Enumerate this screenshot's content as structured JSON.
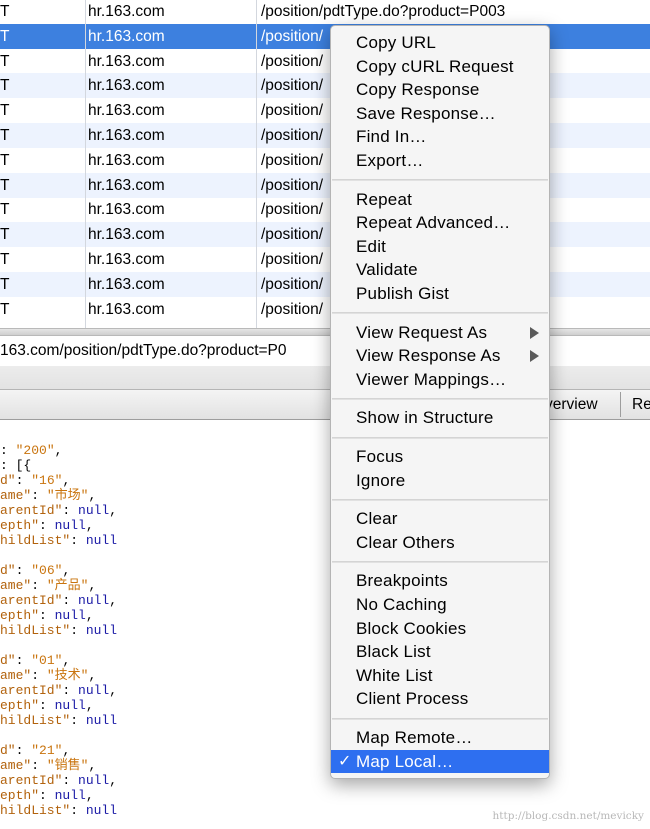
{
  "table": {
    "rows": [
      {
        "method": "T",
        "host": "hr.163.com",
        "path": "/position/pdtType.do?product=P003"
      },
      {
        "method": "T",
        "host": "hr.163.com",
        "path": "/position/"
      },
      {
        "method": "T",
        "host": "hr.163.com",
        "path": "/position/"
      },
      {
        "method": "T",
        "host": "hr.163.com",
        "path": "/position/"
      },
      {
        "method": "T",
        "host": "hr.163.com",
        "path": "/position/"
      },
      {
        "method": "T",
        "host": "hr.163.com",
        "path": "/position/"
      },
      {
        "method": "T",
        "host": "hr.163.com",
        "path": "/position/"
      },
      {
        "method": "T",
        "host": "hr.163.com",
        "path": "/position/"
      },
      {
        "method": "T",
        "host": "hr.163.com",
        "path": "/position/"
      },
      {
        "method": "T",
        "host": "hr.163.com",
        "path": "/position/"
      },
      {
        "method": "T",
        "host": "hr.163.com",
        "path": "/position/"
      },
      {
        "method": "T",
        "host": "hr.163.com",
        "path": "/position/"
      },
      {
        "method": "T",
        "host": "hr.163.com",
        "path": "/position/"
      }
    ]
  },
  "url_bar": {
    "text": "163.com/position/pdtType.do?product=P0"
  },
  "tabs": {
    "overview": "verview",
    "re": "Re"
  },
  "json": {
    "code_key": ": ",
    "code_val": "\"200\"",
    "data_open": ": [{",
    "items": [
      {
        "id": "\"16\"",
        "name": "\"市场\""
      },
      {
        "id": "\"06\"",
        "name": "\"产品\""
      },
      {
        "id": "\"01\"",
        "name": "\"技术\""
      },
      {
        "id": "\"21\"",
        "name": "\"销售\""
      }
    ],
    "null": "null",
    "k_id": "d\"",
    "k_name": "ame\"",
    "k_parent": "arentId\"",
    "k_depth": "epth\"",
    "k_child": "hildList\""
  },
  "watermark": "http://blog.csdn.net/mevicky",
  "menu": {
    "groups": [
      [
        "Copy URL",
        "Copy cURL Request",
        "Copy Response",
        "Save Response…",
        "Find In…",
        "Export…"
      ],
      [
        "Repeat",
        "Repeat Advanced…",
        "Edit",
        "Validate",
        "Publish Gist"
      ],
      [
        "View Request As",
        "View Response As",
        "Viewer Mappings…"
      ],
      [
        "Show in Structure"
      ],
      [
        "Focus",
        "Ignore"
      ],
      [
        "Clear",
        "Clear Others"
      ],
      [
        "Breakpoints",
        "No Caching",
        "Block Cookies",
        "Black List",
        "White List",
        "Client Process"
      ],
      [
        "Map Remote…",
        "Map Local…"
      ]
    ],
    "checkmark": "✓"
  }
}
